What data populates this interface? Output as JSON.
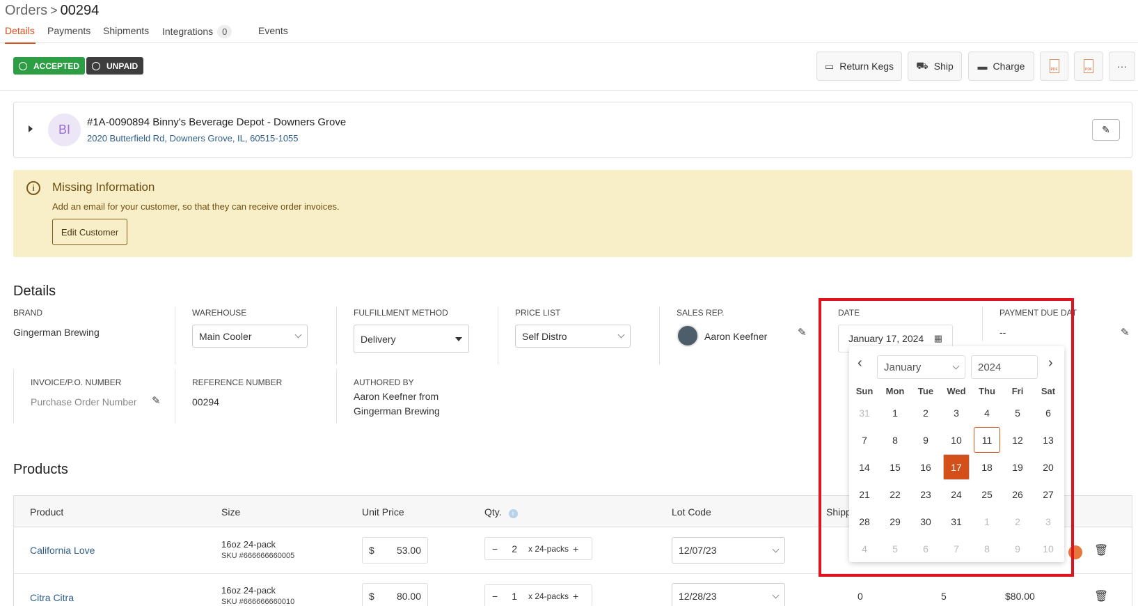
{
  "breadcrumb": {
    "parent": "Orders",
    "separator": ">",
    "current": "00294"
  },
  "tabs": [
    {
      "label": "Details"
    },
    {
      "label": "Payments"
    },
    {
      "label": "Shipments"
    },
    {
      "label": "Integrations",
      "count": "0"
    },
    {
      "label": "Events"
    }
  ],
  "status": {
    "accepted": "ACCEPTED",
    "unpaid": "UNPAID",
    "accepted_color": "#2e9e45",
    "unpaid_color": "#3d3d3d"
  },
  "toolbar": {
    "return_kegs": "Return Kegs",
    "ship": "Ship",
    "charge": "Charge",
    "more": "···"
  },
  "customer": {
    "initials": "BI",
    "name": "#1A-0090894 Binny's Beverage Depot - Downers Grove",
    "address": "2020 Butterfield Rd, Downers Grove, IL, 60515-1055"
  },
  "alert": {
    "title": "Missing Information",
    "message": "Add an email for your customer, so that they can receive order invoices.",
    "button": "Edit Customer"
  },
  "details": {
    "heading": "Details",
    "brand": {
      "label": "BRAND",
      "value": "Gingerman Brewing"
    },
    "warehouse": {
      "label": "WAREHOUSE",
      "value": "Main Cooler"
    },
    "fulfillment": {
      "label": "FULFILLMENT METHOD",
      "value": "Delivery"
    },
    "price_list": {
      "label": "PRICE LIST",
      "value": "Self Distro"
    },
    "sales_rep": {
      "label": "SALES REP.",
      "value": "Aaron Keefner"
    },
    "date": {
      "label": "DATE",
      "value": "January 17, 2024"
    },
    "payment_due": {
      "label": "PAYMENT DUE DATE",
      "value": "--"
    },
    "invoice": {
      "label": "INVOICE/P.O. NUMBER",
      "placeholder": "Purchase Order Number"
    },
    "reference": {
      "label": "REFERENCE NUMBER",
      "value": "00294"
    },
    "authored": {
      "label": "AUTHORED BY",
      "line1": "Aaron Keefner from",
      "line2": "Gingerman Brewing"
    }
  },
  "calendar": {
    "month": "January",
    "year": "2024",
    "dow": [
      "Sun",
      "Mon",
      "Tue",
      "Wed",
      "Thu",
      "Fri",
      "Sat"
    ],
    "weeks": [
      [
        "31",
        "1",
        "2",
        "3",
        "4",
        "5",
        "6"
      ],
      [
        "7",
        "8",
        "9",
        "10",
        "11",
        "12",
        "13"
      ],
      [
        "14",
        "15",
        "16",
        "17",
        "18",
        "19",
        "20"
      ],
      [
        "21",
        "22",
        "23",
        "24",
        "25",
        "26",
        "27"
      ],
      [
        "28",
        "29",
        "30",
        "31",
        "1",
        "2",
        "3"
      ],
      [
        "4",
        "5",
        "6",
        "7",
        "8",
        "9",
        "10"
      ]
    ],
    "today": "11",
    "selected": "17",
    "accent": "#d3501b"
  },
  "products": {
    "heading": "Products",
    "columns": {
      "product": "Product",
      "size": "Size",
      "unit_price": "Unit Price",
      "qty": "Qty.",
      "lot_code": "Lot Code",
      "shipped": "Shipp"
    },
    "rows": [
      {
        "name": "California Love",
        "size": "16oz 24-pack",
        "sku": "SKU #666666660005",
        "currency": "$",
        "price": "53.00",
        "qty": "2",
        "unit": "x 24-packs",
        "lot": "12/07/23"
      },
      {
        "name": "Citra Citra",
        "size": "16oz 24-pack",
        "sku": "SKU #666666660010",
        "currency": "$",
        "price": "80.00",
        "qty": "1",
        "unit": "x 24-packs",
        "lot": "12/28/23",
        "shipped": "0",
        "col2": "5",
        "total": "$80.00"
      }
    ]
  }
}
